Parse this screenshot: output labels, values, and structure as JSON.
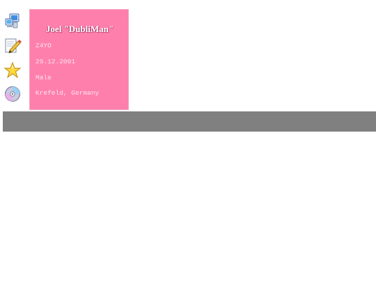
{
  "icons": [
    {
      "name": "computer-icon"
    },
    {
      "name": "edit-note-icon"
    },
    {
      "name": "star-icon"
    },
    {
      "name": "disc-icon"
    }
  ],
  "profile": {
    "name": "Joel \"DubliMan\"",
    "age": "Z4YO",
    "birthdate": "29.12.2001",
    "gender": "Male",
    "location": "Krefeld, Germany"
  },
  "colors": {
    "card_background": "#ff7fac",
    "bar_background": "#808080"
  }
}
